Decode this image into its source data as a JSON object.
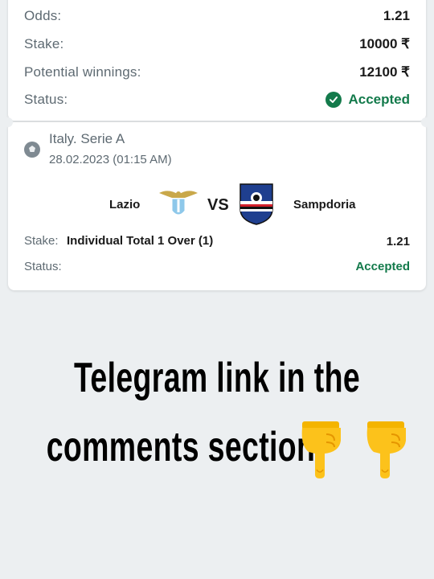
{
  "summary": {
    "odds_label": "Odds:",
    "odds_value": "1.21",
    "stake_label": "Stake:",
    "stake_value": "10000 ₹",
    "potential_label": "Potential winnings:",
    "potential_value": "12100 ₹",
    "status_label": "Status:",
    "status_value": "Accepted"
  },
  "event": {
    "league": "Italy. Serie A",
    "date": "28.02.2023 (01:15 AM)",
    "home_team": "Lazio",
    "vs": "VS",
    "away_team": "Sampdoria",
    "stake_label": "Stake:",
    "bet_name": "Individual Total 1 Over (1)",
    "bet_odds": "1.21",
    "status_label": "Status:",
    "status_value": "Accepted"
  },
  "overlay": {
    "line1": "Telegram link in the",
    "line2": "comments section"
  },
  "colors": {
    "accepted": "#137a4b",
    "background": "#eceff1"
  },
  "icons": [
    "check-circle-icon",
    "airplane-icon",
    "football-icon",
    "lazio-eagle-logo",
    "sampdoria-crest-logo",
    "pointing-down-emoji"
  ]
}
